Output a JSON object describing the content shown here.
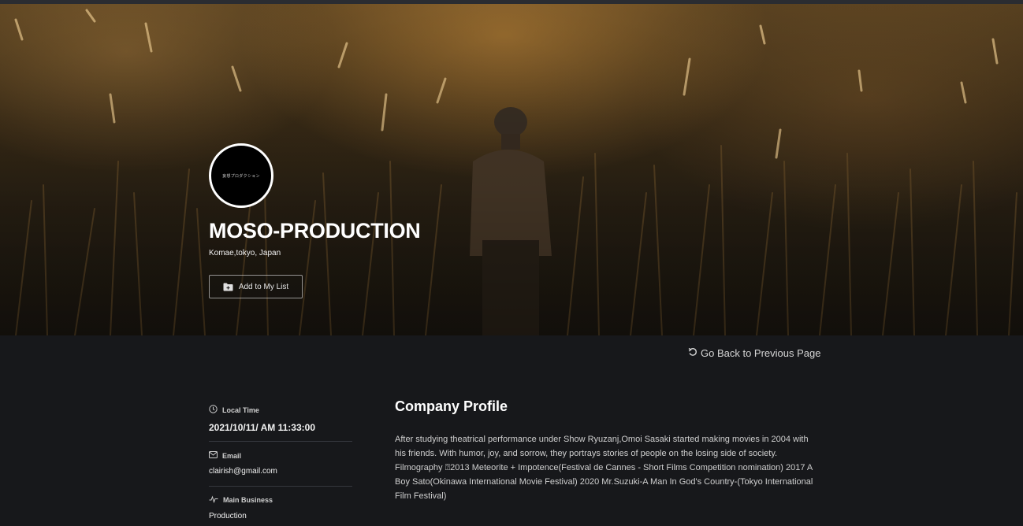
{
  "hero": {
    "avatar_text": "妄想プロダクション",
    "company_name": "MOSO-PRODUCTION",
    "location": "Komae,tokyo, Japan",
    "add_button_label": "Add to My List",
    "add_icon": "folder-plus-icon"
  },
  "nav": {
    "go_back_label": "Go Back to Previous Page",
    "go_back_icon": "undo-arrow-icon"
  },
  "sidebar": {
    "local_time": {
      "label": "Local Time",
      "value": "2021/10/11/ AM 11:33:00",
      "icon": "clock-icon"
    },
    "email": {
      "label": "Email",
      "value": "clairish@gmail.com",
      "icon": "mail-icon"
    },
    "main_business": {
      "label": "Main Business",
      "value": "Production",
      "icon": "pulse-icon"
    }
  },
  "profile": {
    "title": "Company Profile",
    "description": "After studying theatrical performance under Show Ryuzanj,Omoi Sasaki started making movies in 2004 with his friends. With humor, joy, and sorrow, they portrays stories of people on the losing side of society. Filmography ⍰2013 Meteorite + Impotence(Festival de Cannes - Short Films Competition nomination) 2017 A Boy Sato(Okinawa International Movie Festival) 2020 Mr.Suzuki-A Man In God's Country-(Tokyo International Film Festival)"
  },
  "colors": {
    "background": "#17181b",
    "hero_warm": "#d6963e",
    "text_primary": "#ffffff",
    "text_secondary": "#cfcfcf"
  }
}
